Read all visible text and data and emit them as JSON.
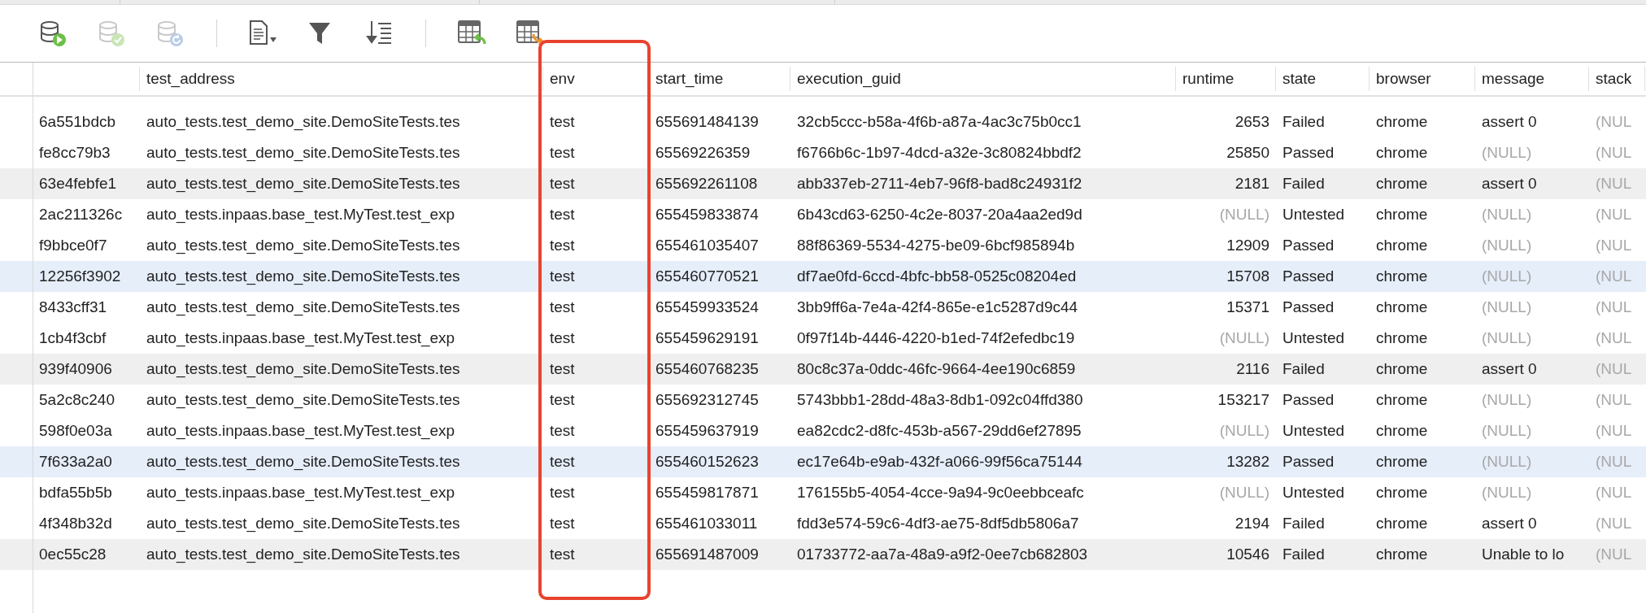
{
  "toolbar": [
    {
      "kind": "db-run",
      "disabled": false
    },
    {
      "kind": "db-check",
      "disabled": true
    },
    {
      "kind": "db-refresh",
      "disabled": true
    },
    {
      "kind": "separator"
    },
    {
      "kind": "document-menu",
      "disabled": false
    },
    {
      "kind": "filter",
      "disabled": false
    },
    {
      "kind": "sort",
      "disabled": false
    },
    {
      "kind": "separator"
    },
    {
      "kind": "table-import",
      "disabled": false
    },
    {
      "kind": "table-export",
      "disabled": false
    }
  ],
  "table": {
    "columns": [
      {},
      {
        "label": "test_address"
      },
      {
        "label": "env"
      },
      {
        "label": "start_time"
      },
      {
        "label": "execution_guid"
      },
      {
        "label": "runtime",
        "kind": "numeric"
      },
      {
        "label": "state"
      },
      {
        "label": "browser"
      },
      {
        "label": "message"
      },
      {
        "label": "stack"
      }
    ],
    "rows": [
      {
        "striped": false,
        "highlighted": false,
        "cells": [
          "6a551bdcb",
          "auto_tests.test_demo_site.DemoSiteTests.tes",
          "test",
          "655691484139",
          "32cb5ccc-b58a-4f6b-a87a-4ac3c75b0cc1",
          "2653",
          "Failed",
          "chrome",
          "assert 0",
          {
            "text": "(NUL",
            "kind": "null"
          }
        ]
      },
      {
        "striped": false,
        "highlighted": false,
        "cells": [
          "fe8cc79b3",
          "auto_tests.test_demo_site.DemoSiteTests.tes",
          "test",
          "65569226359",
          "f6766b6c-1b97-4dcd-a32e-3c80824bbdf2",
          "25850",
          "Passed",
          "chrome",
          {
            "text": "(NULL)",
            "kind": "null"
          },
          {
            "text": "(NUL",
            "kind": "null"
          }
        ]
      },
      {
        "striped": true,
        "highlighted": false,
        "cells": [
          "63e4febfe1",
          "auto_tests.test_demo_site.DemoSiteTests.tes",
          "test",
          "655692261108",
          "abb337eb-2711-4eb7-96f8-bad8c24931f2",
          "2181",
          "Failed",
          "chrome",
          "assert 0",
          {
            "text": "(NUL",
            "kind": "null"
          }
        ]
      },
      {
        "striped": false,
        "highlighted": false,
        "cells": [
          "2ac211326c",
          "auto_tests.inpaas.base_test.MyTest.test_exp",
          "test",
          "655459833874",
          "6b43cd63-6250-4c2e-8037-20a4aa2ed9d",
          {
            "text": "(NULL)",
            "kind": "null"
          },
          "Untested",
          "chrome",
          {
            "text": "(NULL)",
            "kind": "null"
          },
          {
            "text": "(NUL",
            "kind": "null"
          }
        ]
      },
      {
        "striped": false,
        "highlighted": false,
        "cells": [
          "f9bbce0f7",
          "auto_tests.test_demo_site.DemoSiteTests.tes",
          "test",
          "655461035407",
          "88f86369-5534-4275-be09-6bcf985894b",
          "12909",
          "Passed",
          "chrome",
          {
            "text": "(NULL)",
            "kind": "null"
          },
          {
            "text": "(NUL",
            "kind": "null"
          }
        ]
      },
      {
        "striped": false,
        "highlighted": true,
        "cells": [
          "12256f3902",
          "auto_tests.test_demo_site.DemoSiteTests.tes",
          "test",
          "655460770521",
          "df7ae0fd-6ccd-4bfc-bb58-0525c08204ed",
          "15708",
          "Passed",
          "chrome",
          {
            "text": "(NULL)",
            "kind": "null"
          },
          {
            "text": "(NUL",
            "kind": "null"
          }
        ]
      },
      {
        "striped": false,
        "highlighted": false,
        "cells": [
          "8433cff31",
          "auto_tests.test_demo_site.DemoSiteTests.tes",
          "test",
          "655459933524",
          "3bb9ff6a-7e4a-42f4-865e-e1c5287d9c44",
          "15371",
          "Passed",
          "chrome",
          {
            "text": "(NULL)",
            "kind": "null"
          },
          {
            "text": "(NUL",
            "kind": "null"
          }
        ]
      },
      {
        "striped": false,
        "highlighted": false,
        "cells": [
          "1cb4f3cbf",
          "auto_tests.inpaas.base_test.MyTest.test_exp",
          "test",
          "655459629191",
          "0f97f14b-4446-4220-b1ed-74f2efedbc19",
          {
            "text": "(NULL)",
            "kind": "null"
          },
          "Untested",
          "chrome",
          {
            "text": "(NULL)",
            "kind": "null"
          },
          {
            "text": "(NUL",
            "kind": "null"
          }
        ]
      },
      {
        "striped": true,
        "highlighted": false,
        "cells": [
          "939f40906",
          "auto_tests.test_demo_site.DemoSiteTests.tes",
          "test",
          "655460768235",
          "80c8c37a-0ddc-46fc-9664-4ee190c6859",
          "2116",
          "Failed",
          "chrome",
          "assert 0",
          {
            "text": "(NUL",
            "kind": "null"
          }
        ]
      },
      {
        "striped": false,
        "highlighted": false,
        "cells": [
          "5a2c8c240",
          "auto_tests.test_demo_site.DemoSiteTests.tes",
          "test",
          "655692312745",
          "5743bbb1-28dd-48a3-8db1-092c04ffd380",
          "153217",
          "Passed",
          "chrome",
          {
            "text": "(NULL)",
            "kind": "null"
          },
          {
            "text": "(NUL",
            "kind": "null"
          }
        ]
      },
      {
        "striped": false,
        "highlighted": false,
        "cells": [
          "598f0e03a",
          "auto_tests.inpaas.base_test.MyTest.test_exp",
          "test",
          "655459637919",
          "ea82cdc2-d8fc-453b-a567-29dd6ef27895",
          {
            "text": "(NULL)",
            "kind": "null"
          },
          "Untested",
          "chrome",
          {
            "text": "(NULL)",
            "kind": "null"
          },
          {
            "text": "(NUL",
            "kind": "null"
          }
        ]
      },
      {
        "striped": false,
        "highlighted": true,
        "cells": [
          "7f633a2a0",
          "auto_tests.test_demo_site.DemoSiteTests.tes",
          "test",
          "655460152623",
          "ec17e64b-e9ab-432f-a066-99f56ca75144",
          "13282",
          "Passed",
          "chrome",
          {
            "text": "(NULL)",
            "kind": "null"
          },
          {
            "text": "(NUL",
            "kind": "null"
          }
        ]
      },
      {
        "striped": false,
        "highlighted": false,
        "cells": [
          "bdfa55b5b",
          "auto_tests.inpaas.base_test.MyTest.test_exp",
          "test",
          "655459817871",
          "176155b5-4054-4cce-9a94-9c0eebbceafc",
          {
            "text": "(NULL)",
            "kind": "null"
          },
          "Untested",
          "chrome",
          {
            "text": "(NULL)",
            "kind": "null"
          },
          {
            "text": "(NUL",
            "kind": "null"
          }
        ]
      },
      {
        "striped": false,
        "highlighted": false,
        "cells": [
          "4f348b32d",
          "auto_tests.test_demo_site.DemoSiteTests.tes",
          "test",
          "655461033011",
          "fdd3e574-59c6-4df3-ae75-8df5db5806a7",
          "2194",
          "Failed",
          "chrome",
          "assert 0",
          {
            "text": "(NUL",
            "kind": "null"
          }
        ]
      },
      {
        "striped": true,
        "highlighted": false,
        "cells": [
          "0ec55c28",
          "auto_tests.test_demo_site.DemoSiteTests.tes",
          "test",
          "655691487009",
          "01733772-aa7a-48a9-a9f2-0ee7cb682803",
          "10546",
          "Failed",
          "chrome",
          "Unable to lo",
          {
            "text": "(NUL",
            "kind": "null"
          }
        ]
      }
    ]
  }
}
